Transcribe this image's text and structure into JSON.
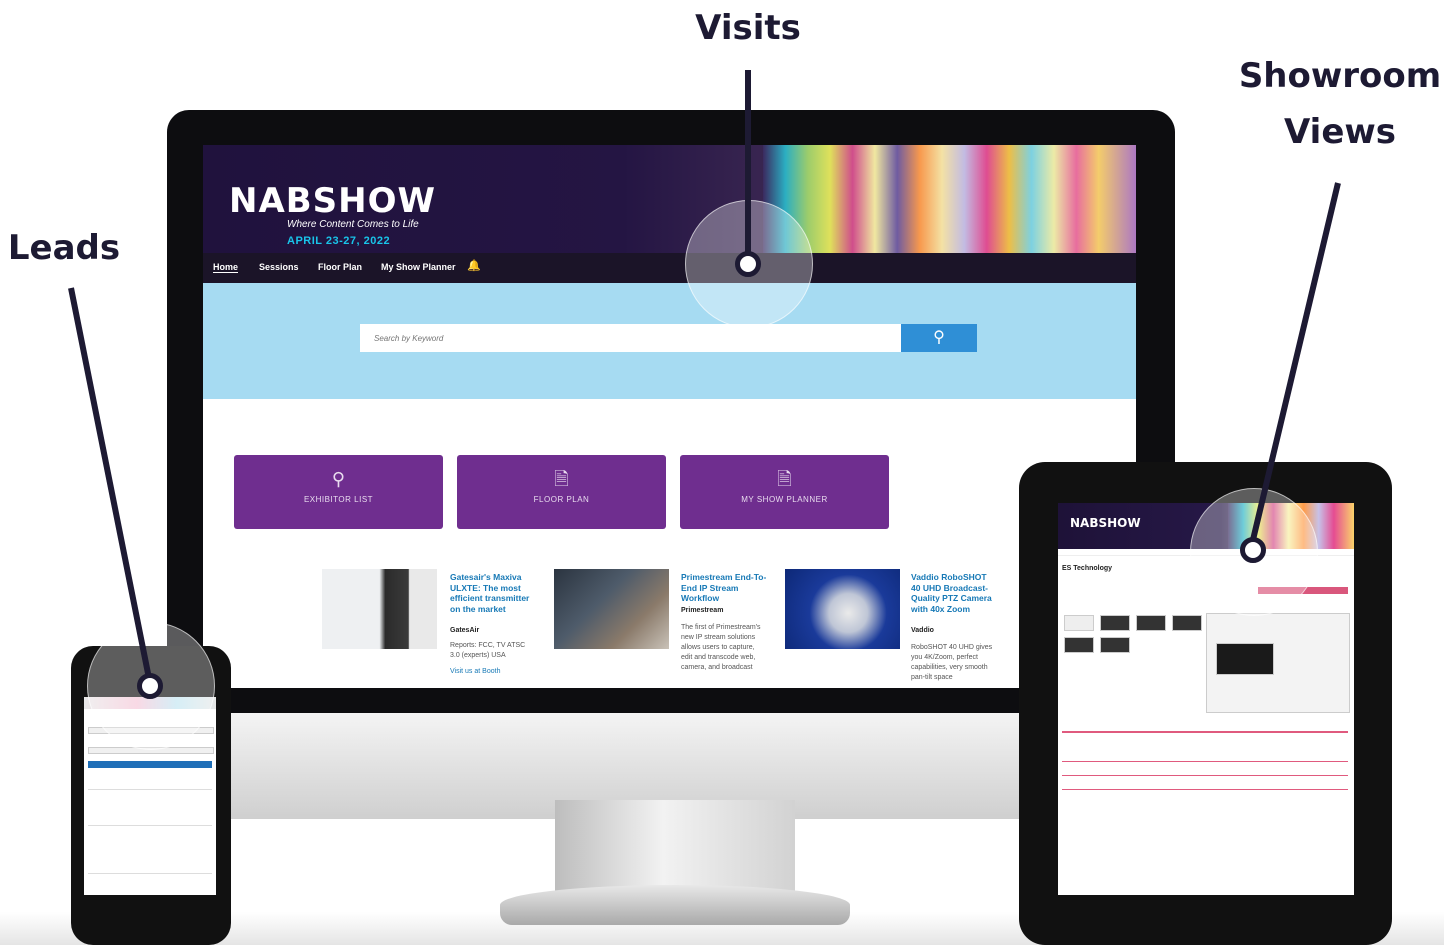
{
  "callouts": {
    "visits": "Visits",
    "showroom_line1": "Showroom",
    "showroom_line2": "Views",
    "leads": "Leads"
  },
  "site": {
    "logo": "NABSHOW",
    "tagline": "Where Content Comes to Life",
    "dates": "APRIL 23-27, 2022",
    "nav": [
      "Home",
      "Sessions",
      "Floor Plan",
      "My Show Planner"
    ],
    "search_placeholder": "Search by Keyword",
    "tiles": [
      {
        "icon": "search-icon",
        "label": "EXHIBITOR LIST"
      },
      {
        "icon": "document-icon",
        "label": "FLOOR PLAN"
      },
      {
        "icon": "document-icon",
        "label": "MY SHOW PLANNER"
      }
    ],
    "news": [
      {
        "title": "Gatesair's Maxiva ULXTE: The most efficient transmitter on the market",
        "company": "GatesAir",
        "body": "Reports: FCC, TV ATSC 3.0 (experts) USA",
        "link": "Visit us at Booth"
      },
      {
        "title": "Primestream End-To-End IP Stream Workflow",
        "company": "Primestream",
        "body": "The first of Primestream's new IP stream solutions allows users to capture, edit and transcode web, camera, and broadcast"
      },
      {
        "title": "Vaddio RoboSHOT 40 UHD Broadcast-Quality PTZ Camera with 40x Zoom",
        "company": "Vaddio",
        "body": "RoboSHOT 40 UHD gives you 4K/Zoom, perfect capabilities, very smooth pan-tilt space"
      }
    ]
  },
  "tablet": {
    "logo": "NABSHOW",
    "company": "ES Technology"
  },
  "colors": {
    "callout": "#1d1a33",
    "header": "#20123d",
    "hero": "#a6dbf2",
    "search_button": "#2f8fd6",
    "tile": "#6f2e8f",
    "news_title": "#1779b6",
    "date": "#19c4e9"
  }
}
